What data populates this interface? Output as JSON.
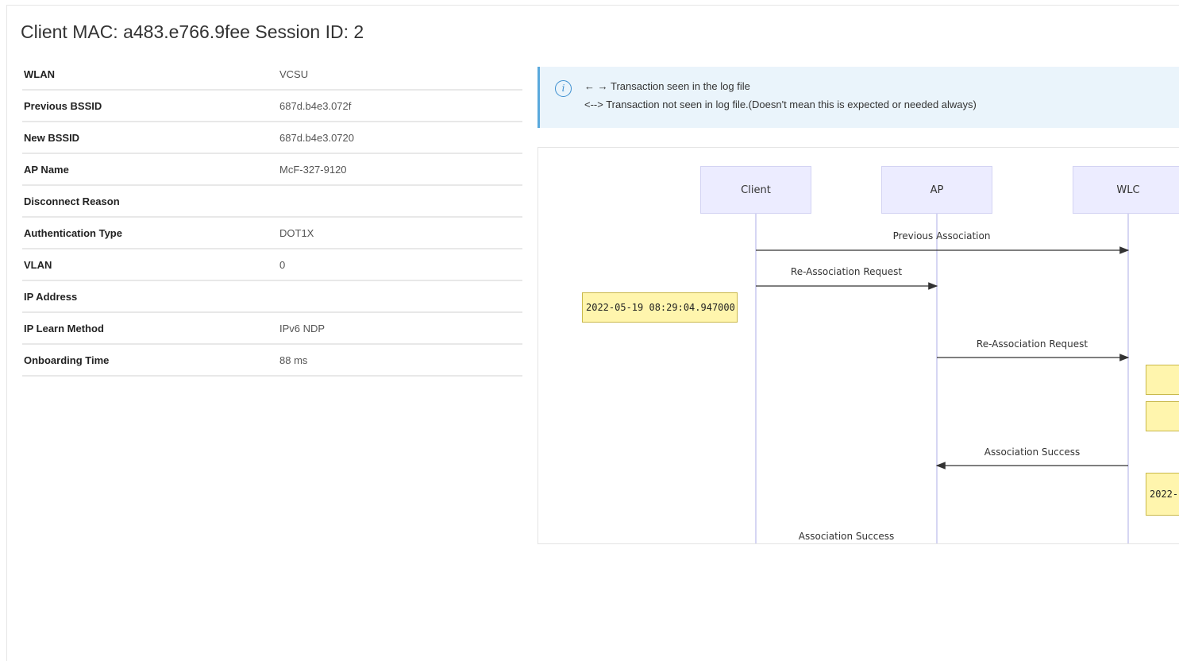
{
  "title": "Client MAC: a483.e766.9fee Session ID: 2",
  "details": [
    {
      "label": "WLAN",
      "value": "VCSU"
    },
    {
      "label": "Previous BSSID",
      "value": "687d.b4e3.072f"
    },
    {
      "label": "New BSSID",
      "value": "687d.b4e3.0720"
    },
    {
      "label": "AP Name",
      "value": "McF-327-9120"
    },
    {
      "label": "Disconnect Reason",
      "value": ""
    },
    {
      "label": "Authentication Type",
      "value": "DOT1X"
    },
    {
      "label": "VLAN",
      "value": "0"
    },
    {
      "label": "IP Address",
      "value": ""
    },
    {
      "label": "IP Learn Method",
      "value": "IPv6 NDP"
    },
    {
      "label": "Onboarding Time",
      "value": "88 ms"
    }
  ],
  "info": {
    "icon": "info-icon",
    "line1": "← → Transaction seen in the log file",
    "line2": "<--> Transaction not seen in log file.(Doesn't mean this is expected or needed always)"
  },
  "diagram": {
    "actors": [
      "Client",
      "AP",
      "WLC"
    ],
    "messages": [
      {
        "label": "Previous Association",
        "from": "Client",
        "to": "WLC"
      },
      {
        "label": "Re-Association Request",
        "from": "Client",
        "to": "AP"
      },
      {
        "label": "Re-Association Request",
        "from": "AP",
        "to": "WLC"
      },
      {
        "label": "Association Success",
        "from": "WLC",
        "to": "AP"
      },
      {
        "label": "Association Success",
        "from": "AP",
        "to": "Client"
      }
    ],
    "notes": [
      {
        "text": "2022-05-19 08:29:04.947000"
      },
      {
        "text": ""
      },
      {
        "text": ""
      },
      {
        "text": "2022-"
      }
    ]
  }
}
